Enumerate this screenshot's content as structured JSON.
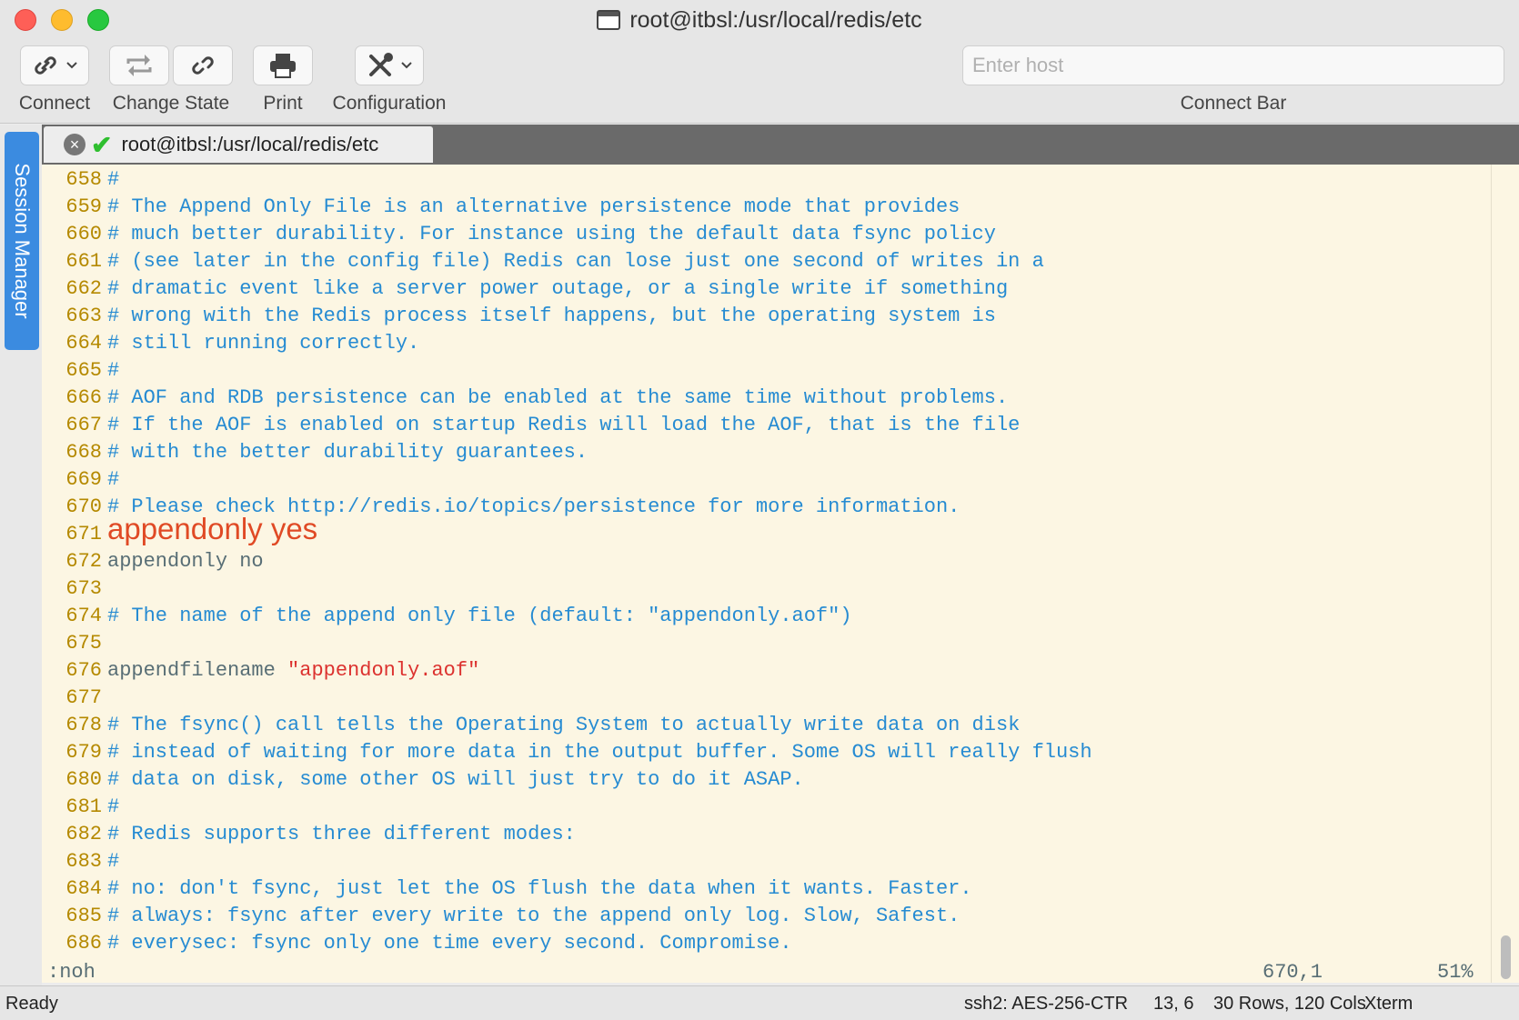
{
  "window": {
    "title": "root@itbsl:/usr/local/redis/etc"
  },
  "toolbar": {
    "connect_label": "Connect",
    "change_state_label": "Change State",
    "print_label": "Print",
    "configuration_label": "Configuration",
    "host_placeholder": "Enter host",
    "connect_bar_label": "Connect Bar"
  },
  "sidebar": {
    "session_manager_label": "Session Manager"
  },
  "tab": {
    "title": "root@itbsl:/usr/local/redis/etc"
  },
  "terminal": {
    "lines": [
      {
        "num": "658",
        "text": "#"
      },
      {
        "num": "659",
        "text": "# The Append Only File is an alternative persistence mode that provides"
      },
      {
        "num": "660",
        "text": "# much better durability. For instance using the default data fsync policy"
      },
      {
        "num": "661",
        "text": "# (see later in the config file) Redis can lose just one second of writes in a"
      },
      {
        "num": "662",
        "text": "# dramatic event like a server power outage, or a single write if something"
      },
      {
        "num": "663",
        "text": "# wrong with the Redis process itself happens, but the operating system is"
      },
      {
        "num": "664",
        "text": "# still running correctly."
      },
      {
        "num": "665",
        "text": "#"
      },
      {
        "num": "666",
        "text": "# AOF and RDB persistence can be enabled at the same time without problems."
      },
      {
        "num": "667",
        "text": "# If the AOF is enabled on startup Redis will load the AOF, that is the file"
      },
      {
        "num": "668",
        "text": "# with the better durability guarantees."
      },
      {
        "num": "669",
        "text": "#"
      },
      {
        "num": "670",
        "text": "# Please check http://redis.io/topics/persistence for more information."
      },
      {
        "num": "671",
        "text": "appendonly yes"
      },
      {
        "num": "672",
        "text": "appendonly no"
      },
      {
        "num": "673",
        "text": ""
      },
      {
        "num": "674",
        "text": "# The name of the append only file (default: \"appendonly.aof\")"
      },
      {
        "num": "675",
        "text": ""
      },
      {
        "num": "676",
        "text": "appendfilename ",
        "string": "\"appendonly.aof\""
      },
      {
        "num": "677",
        "text": ""
      },
      {
        "num": "678",
        "text": "# The fsync() call tells the Operating System to actually write data on disk"
      },
      {
        "num": "679",
        "text": "# instead of waiting for more data in the output buffer. Some OS will really flush"
      },
      {
        "num": "680",
        "text": "# data on disk, some other OS will just try to do it ASAP."
      },
      {
        "num": "681",
        "text": "#"
      },
      {
        "num": "682",
        "text": "# Redis supports three different modes:"
      },
      {
        "num": "683",
        "text": "#"
      },
      {
        "num": "684",
        "text": "# no: don't fsync, just let the OS flush the data when it wants. Faster."
      },
      {
        "num": "685",
        "text": "# always: fsync after every write to the append only log. Slow, Safest."
      },
      {
        "num": "686",
        "text": "# everysec: fsync only one time every second. Compromise."
      }
    ],
    "command_line": ":noh",
    "cursor_position": "670,1",
    "scroll_percent": "51%"
  },
  "statusbar": {
    "state": "Ready",
    "cipher": "ssh2: AES-256-CTR",
    "cursor": "13, 6",
    "size": "30 Rows, 120 Cols",
    "emulation": "Xterm"
  },
  "colors": {
    "terminal_bg": "#fcf6e3",
    "line_number": "#b58900",
    "comment": "#268bd2",
    "plain": "#586e75",
    "string": "#dc322f",
    "annotation": "#e04a25",
    "session_tab": "#3b8be0"
  }
}
